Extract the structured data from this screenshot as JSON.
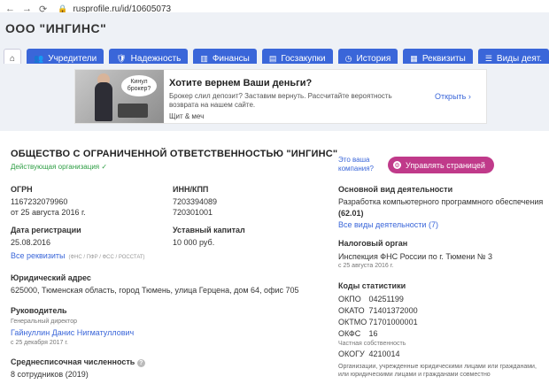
{
  "browser": {
    "url": "rusprofile.ru/id/10605073"
  },
  "header": {
    "cut_title": "ООО \"ИНГИНС\""
  },
  "tabs": [
    {
      "label": "Учредители",
      "icon": "users-icon"
    },
    {
      "label": "Надежность",
      "icon": "shield-check-icon"
    },
    {
      "label": "Финансы",
      "icon": "bar-chart-icon"
    },
    {
      "label": "Госзакупки",
      "icon": "tender-icon"
    },
    {
      "label": "История",
      "icon": "history-icon"
    },
    {
      "label": "Реквизиты",
      "icon": "document-icon"
    },
    {
      "label": "Виды деят.",
      "icon": "list-icon"
    }
  ],
  "ad": {
    "bubble": "Кинул брокер?",
    "title": "Хотите вернем Ваши деньги?",
    "text": "Брокер слил депозит? Заставим вернуть. Рассчитайте вероятность возврата на нашем сайте.",
    "brand": "Щит & меч",
    "open": "Открыть"
  },
  "company": {
    "title": "ОБЩЕСТВО С ОГРАНИЧЕННОЙ ОТВЕТСТВЕННОСТЬЮ \"ИНГИНС\"",
    "status": "Действующая организация",
    "ogrn_label": "ОГРН",
    "ogrn": "1167232079960",
    "ogrn_date": "от 25 августа 2016 г.",
    "inn_kpp_label": "ИНН/КПП",
    "inn": "7203394089",
    "kpp": "720301001",
    "reg_label": "Дата регистрации",
    "reg_date": "25.08.2016",
    "capital_label": "Уставный капитал",
    "capital": "10 000 руб.",
    "all_requisites": "Все реквизиты",
    "requisites_note": "(ФНС / ПФР / ФСС / РОССТАТ)",
    "address_label": "Юридический адрес",
    "address": "625000, Тюменская область, город Тюмень, улица Герцена, дом 64, офис 705",
    "head_label": "Руководитель",
    "head_role": "Генеральный директор",
    "head_name": "Гайнуллин Данис Нигматуллович",
    "head_since": "с 25 декабря 2017 г.",
    "employees_label": "Среднесписочная численность",
    "employees": "8 сотрудников (2019)"
  },
  "right": {
    "manage_question_1": "Это ваша",
    "manage_question_2": "компания?",
    "manage_button": "Управлять страницей",
    "activity_label": "Основной вид деятельности",
    "activity": "Разработка компьютерного программного обеспечения",
    "activity_code": "(62.01)",
    "all_activities": "Все виды деятельности (7)",
    "tax_label": "Налоговый орган",
    "tax": "Инспекция ФНС России по г. Тюмени № 3",
    "tax_since": "с 25 августа 2016 г.",
    "codes_label": "Коды статистики",
    "codes": [
      {
        "k": "ОКПО",
        "v": "04251199"
      },
      {
        "k": "ОКАТО",
        "v": "71401372000"
      },
      {
        "k": "ОКТМО",
        "v": "71701000001"
      },
      {
        "k": "ОКФС",
        "v": "16"
      }
    ],
    "okfs_note": "Частная собственность",
    "okogu_k": "ОКОГУ",
    "okogu_v": "4210014",
    "okogu_note": "Организации, учрежденные юридическими лицами или гражданами, или юридическими лицами и гражданами совместно"
  },
  "colors": {
    "accent": "#3a66d9",
    "active_status": "#2e9e44",
    "manage_button": "#c03a8a"
  }
}
